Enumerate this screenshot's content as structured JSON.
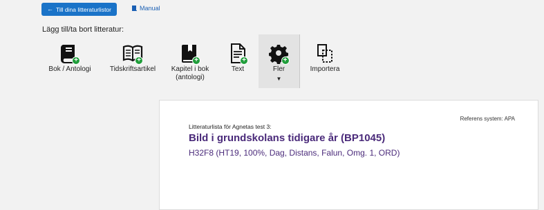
{
  "nav": {
    "back_label": "Till dina litteraturlistor",
    "manual_label": "Manual"
  },
  "section_label": "Lägg till/ta bort litteratur:",
  "tools": [
    {
      "label": "Bok / Antologi",
      "icon": "book-add-icon"
    },
    {
      "label": "Tidskriftsartikel",
      "icon": "journal-add-icon"
    },
    {
      "label": "Kapitel i bok (antologi)",
      "label_line1": "Kapitel i bok",
      "label_line2": "(antologi)",
      "icon": "chapter-add-icon"
    },
    {
      "label": "Text",
      "icon": "text-add-icon"
    },
    {
      "label": "Fler",
      "icon": "gear-add-icon"
    },
    {
      "label": "Importera",
      "icon": "import-icon"
    }
  ],
  "card": {
    "reference_system": "Referens system: APA",
    "list_prefix": "Litteraturlista för Agnetas test 3:",
    "course_title": "Bild i grundskolans tidigare år (BP1045)",
    "course_meta": "H32F8 (HT19, 100%, Dag, Distans, Falun, Omg. 1, ORD)"
  },
  "colors": {
    "primary_button": "#1a73c8",
    "link": "#1a5fb4",
    "title": "#4a2a7a",
    "badge_green": "#1f9d3a"
  }
}
